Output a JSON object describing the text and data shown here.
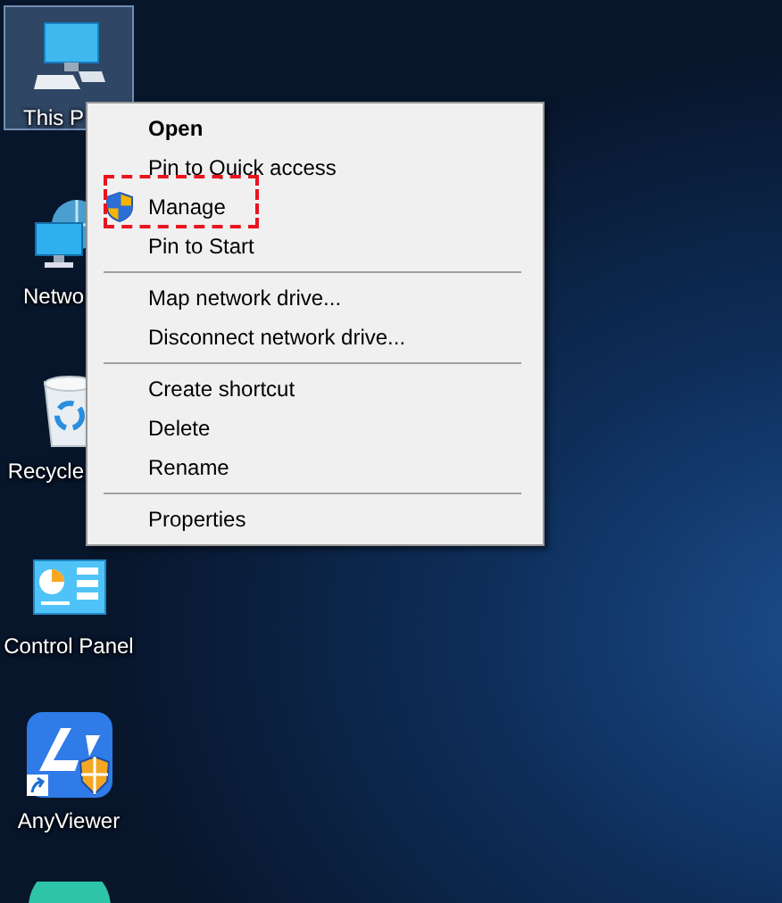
{
  "desktop_icons": [
    {
      "kind": "computer",
      "label": "This P",
      "selected": true
    },
    {
      "kind": "network",
      "label": "Netwo",
      "selected": false
    },
    {
      "kind": "recycle",
      "label": "Recycle",
      "selected": false
    },
    {
      "kind": "control-panel",
      "label": "Control Panel",
      "selected": false
    },
    {
      "kind": "app",
      "label": "AnyViewer",
      "selected": false
    },
    {
      "kind": "round-app",
      "selected": false
    }
  ],
  "context_menu": {
    "items": [
      {
        "kind": "item",
        "label": "Open",
        "default": true,
        "highlighted": false
      },
      {
        "kind": "item",
        "label": "Pin to Quick access",
        "default": false,
        "highlighted": false
      },
      {
        "kind": "item",
        "label": "Manage",
        "default": false,
        "highlighted": true,
        "shield": true
      },
      {
        "kind": "item",
        "label": "Pin to Start",
        "default": false,
        "highlighted": false
      },
      {
        "kind": "separator"
      },
      {
        "kind": "item",
        "label": "Map network drive...",
        "default": false,
        "highlighted": false
      },
      {
        "kind": "item",
        "label": "Disconnect network drive...",
        "default": false,
        "highlighted": false
      },
      {
        "kind": "separator"
      },
      {
        "kind": "item",
        "label": "Create shortcut",
        "default": false,
        "highlighted": false
      },
      {
        "kind": "item",
        "label": "Delete",
        "default": false,
        "highlighted": false
      },
      {
        "kind": "item",
        "label": "Rename",
        "default": false,
        "highlighted": false
      },
      {
        "kind": "separator"
      },
      {
        "kind": "item",
        "label": "Properties",
        "default": false,
        "highlighted": false
      }
    ]
  }
}
